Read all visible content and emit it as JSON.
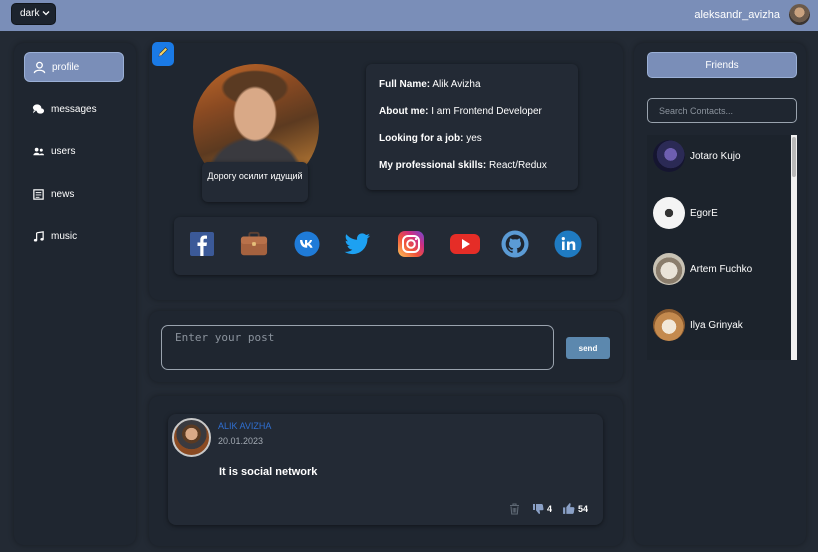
{
  "header": {
    "theme_select_value": "dark",
    "username": "aleksandr_avizha"
  },
  "sidebar": {
    "items": [
      {
        "label": "profile",
        "icon": "person-icon",
        "active": true
      },
      {
        "label": "messages",
        "icon": "chat-bubbles-icon",
        "active": false
      },
      {
        "label": "users",
        "icon": "users-icon",
        "active": false
      },
      {
        "label": "news",
        "icon": "newspaper-icon",
        "active": false
      },
      {
        "label": "music",
        "icon": "music-note-icon",
        "active": false
      }
    ]
  },
  "profile": {
    "edit_icon": "pencil-icon",
    "status_text": "Дорогу осилит идущий",
    "info": [
      {
        "label": "Full Name:",
        "value": "Alik Avizha"
      },
      {
        "label": "About me:",
        "value": "I am Frontend Developer"
      },
      {
        "label": "Looking for a job:",
        "value": "yes"
      },
      {
        "label": "My professional skills:",
        "value": "React/Redux"
      }
    ],
    "socials": [
      "facebook-icon",
      "briefcase-icon",
      "vk-icon",
      "twitter-icon",
      "instagram-icon",
      "youtube-icon",
      "github-icon",
      "linkedin-icon"
    ]
  },
  "new_post": {
    "placeholder": "Enter your post",
    "send_label": "send"
  },
  "posts": [
    {
      "author": "ALIK AVIZHA",
      "date": "20.01.2023",
      "text": "It is social network",
      "dislikes": "4",
      "likes": "54"
    }
  ],
  "friends": {
    "button_label": "Friends",
    "search_placeholder": "Search Contacts...",
    "contacts": [
      {
        "name": "Jotaro Kujo"
      },
      {
        "name": "EgorE"
      },
      {
        "name": "Artem Fuchko"
      },
      {
        "name": "Ilya Grinyak"
      }
    ]
  },
  "colors": {
    "topbar": "#7a8eb8",
    "background": "#232a34",
    "panel": "#1f2630",
    "accent_blue": "#1a7ae6",
    "send_button": "#5c88ae"
  }
}
